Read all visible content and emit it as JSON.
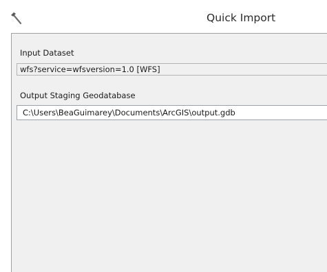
{
  "window": {
    "title": "Quick Import",
    "icon": "hammer-icon"
  },
  "form": {
    "input_dataset": {
      "label": "Input Dataset",
      "value": "wfs?service=wfsversion=1.0 [WFS]"
    },
    "output_geodatabase": {
      "label": "Output Staging Geodatabase",
      "value": "C:\\Users\\BeaGuimarey\\Documents\\ArcGIS\\output.gdb"
    }
  }
}
